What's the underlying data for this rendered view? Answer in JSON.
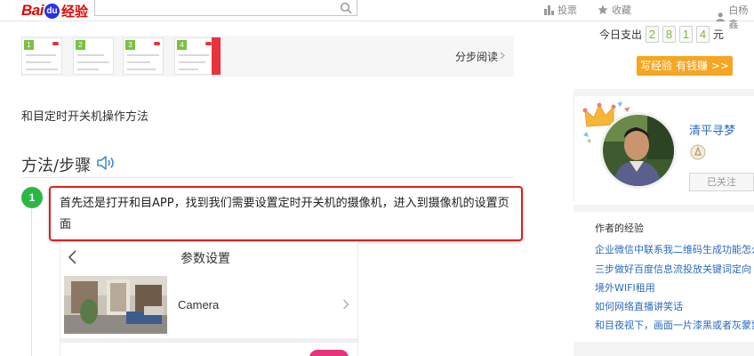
{
  "header": {
    "logo_bai": "Bai",
    "logo_du": "du",
    "logo_jingyan": "经验",
    "search_value": "",
    "nav": [
      {
        "label": "投票",
        "icon": "bar-chart-icon"
      },
      {
        "label": "收藏",
        "icon": "star-icon"
      },
      {
        "label": "白杨鑫",
        "icon": "user-icon"
      }
    ]
  },
  "steps_strip": {
    "thumbs": [
      "1",
      "2",
      "3",
      "4"
    ],
    "link": "分步阅读"
  },
  "intro_text": "和目定时开关机操作方法",
  "section_title": "方法/步骤",
  "step": {
    "number": "1",
    "text": "首先还是打开和目APP，找到我们需要设置定时开关机的摄像机，进入到摄像机的设置页面"
  },
  "phone": {
    "title": "参数设置",
    "camera_label": "Camera"
  },
  "sidebar": {
    "today_label": "今日支出",
    "digits": [
      "2",
      "8",
      "1",
      "4"
    ],
    "unit": "元",
    "write_button": "写经验 有钱赚 >>",
    "author_name": "清平寻梦",
    "follow_label": "已关注",
    "experience_title": "作者的经验",
    "experience_links": [
      "企业微信中联系我二维码生成功能怎么...",
      "三步做好百度信息流投放关键词定向",
      "境外WIFI租用",
      "如何网络直播讲笑话",
      "和目夜视下，画面一片漆黑或者灰蒙蒙..."
    ]
  },
  "colors": {
    "brand_red": "#e10601",
    "brand_blue": "#2932e1",
    "step_green": "#2bb744",
    "highlight_red": "#d9221c",
    "link_blue": "#2a6bc0",
    "button_orange": "#f5a623",
    "digit_green": "#7cb82f"
  }
}
